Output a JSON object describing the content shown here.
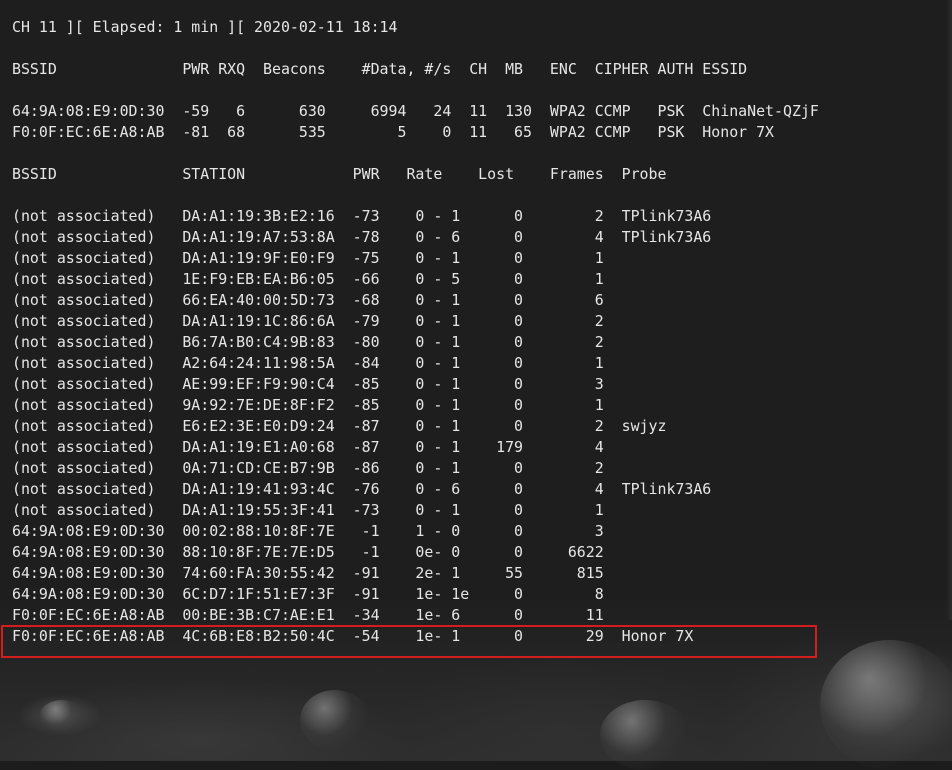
{
  "status_line": "CH 11 ][ Elapsed: 1 min ][ 2020-02-11 18:14",
  "ap_header": "BSSID              PWR RXQ  Beacons    #Data, #/s  CH  MB   ENC  CIPHER AUTH ESSID",
  "ap_rows": [
    "64:9A:08:E9:0D:30  -59   6      630     6994   24  11  130  WPA2 CCMP   PSK  ChinaNet-QZjF",
    "F0:0F:EC:6E:A8:AB  -81  68      535        5    0  11   65  WPA2 CCMP   PSK  Honor 7X"
  ],
  "station_header": "BSSID              STATION            PWR   Rate    Lost    Frames  Probe",
  "station_rows": [
    "(not associated)   DA:A1:19:3B:E2:16  -73    0 - 1      0        2  TPlink73A6",
    "(not associated)   DA:A1:19:A7:53:8A  -78    0 - 6      0        4  TPlink73A6",
    "(not associated)   DA:A1:19:9F:E0:F9  -75    0 - 1      0        1",
    "(not associated)   1E:F9:EB:EA:B6:05  -66    0 - 5      0        1",
    "(not associated)   66:EA:40:00:5D:73  -68    0 - 1      0        6",
    "(not associated)   DA:A1:19:1C:86:6A  -79    0 - 1      0        2",
    "(not associated)   B6:7A:B0:C4:9B:83  -80    0 - 1      0        2",
    "(not associated)   A2:64:24:11:98:5A  -84    0 - 1      0        1",
    "(not associated)   AE:99:EF:F9:90:C4  -85    0 - 1      0        3",
    "(not associated)   9A:92:7E:DE:8F:F2  -85    0 - 1      0        1",
    "(not associated)   E6:E2:3E:E0:D9:24  -87    0 - 1      0        2  swjyz",
    "(not associated)   DA:A1:19:E1:A0:68  -87    0 - 1    179        4",
    "(not associated)   0A:71:CD:CE:B7:9B  -86    0 - 1      0        2",
    "(not associated)   DA:A1:19:41:93:4C  -76    0 - 6      0        4  TPlink73A6",
    "(not associated)   DA:A1:19:55:3F:41  -73    0 - 1      0        1",
    "64:9A:08:E9:0D:30  00:02:88:10:8F:7E   -1    1 - 0      0        3",
    "64:9A:08:E9:0D:30  88:10:8F:7E:7E:D5   -1    0e- 0      0     6622",
    "64:9A:08:E9:0D:30  74:60:FA:30:55:42  -91    2e- 1     55      815",
    "64:9A:08:E9:0D:30  6C:D7:1F:51:E7:3F  -91    1e- 1e     0        8",
    "F0:0F:EC:6E:A8:AB  00:BE:3B:C7:AE:E1  -34    1e- 6      0       11",
    "F0:0F:EC:6E:A8:AB  4C:6B:E8:B2:50:4C  -54    1e- 1      0       29  Honor 7X"
  ],
  "colors": {
    "text": "#e6e6e6",
    "background": "#1c1c1c",
    "highlight_box": "#d41e1e"
  }
}
